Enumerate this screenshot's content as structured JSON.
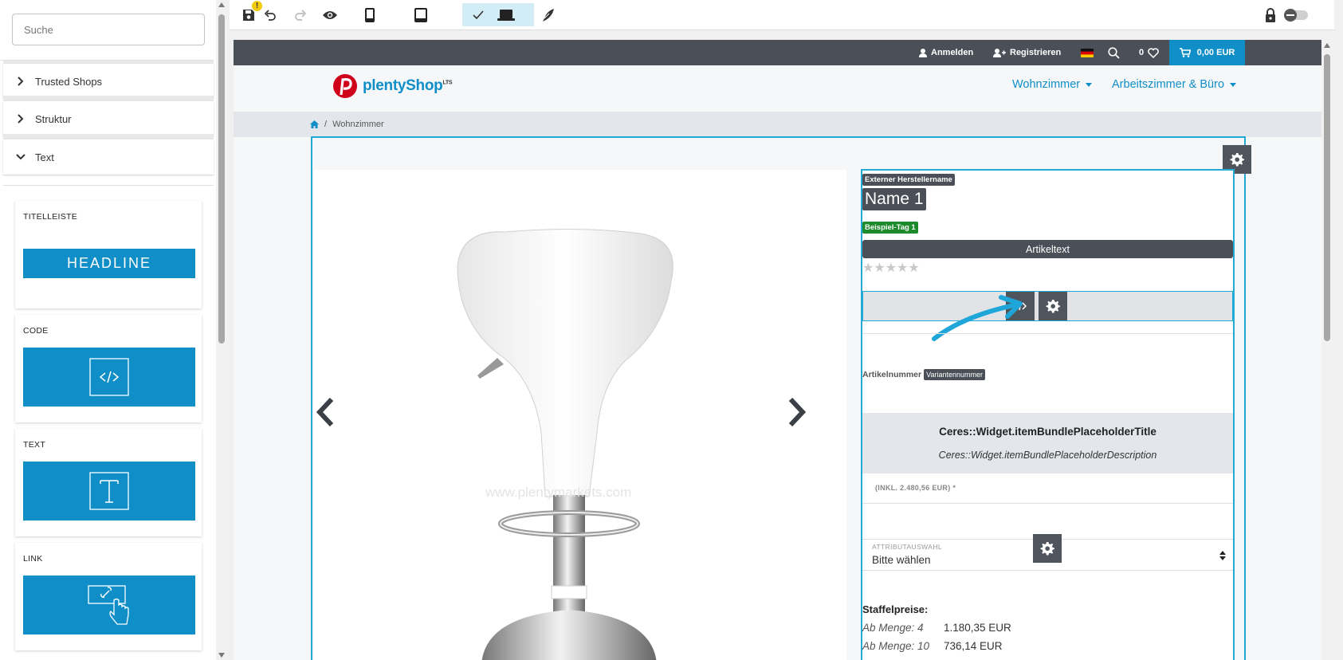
{
  "sidebar": {
    "search_placeholder": "Suche",
    "accordion": [
      {
        "label": "Trusted Shops",
        "expanded": false
      },
      {
        "label": "Struktur",
        "expanded": false
      },
      {
        "label": "Text",
        "expanded": true
      }
    ],
    "widgets": [
      {
        "label": "TITELLEISTE",
        "tile_text": "HEADLINE",
        "icon": "headline-icon"
      },
      {
        "label": "CODE",
        "icon": "code-icon"
      },
      {
        "label": "TEXT",
        "icon": "text-icon"
      },
      {
        "label": "LINK",
        "icon": "link-icon"
      }
    ]
  },
  "toolbar": {
    "tools": [
      "save-icon",
      "undo-icon",
      "redo-icon",
      "preview-eye-icon",
      "mobile-icon",
      "tablet-icon",
      "desktop-icon",
      "pen-icon",
      "lock-icon",
      "toggle-switch"
    ],
    "warning_badge": "!"
  },
  "shop": {
    "topbar": {
      "login": "Anmelden",
      "register": "Registrieren",
      "wishlist_count": "0",
      "cart": "0,00 EUR"
    },
    "logo_text": "plentyShop",
    "logo_sup": "LTS",
    "nav": [
      "Wohnzimmer",
      "Arbeitszimmer & Büro"
    ],
    "breadcrumb": [
      "Wohnzimmer"
    ]
  },
  "item": {
    "manufacturer": "Externer Herstellername",
    "name": "Name 1",
    "tag": "Beispiel-Tag 1",
    "article_text": "Artikeltext",
    "stars": "★★★★★",
    "code_slash": "/",
    "artnum_label": "Artikelnummer",
    "artnum_chip": "Variantennummer",
    "bundle_title": "Ceres::Widget.itemBundlePlaceholderTitle",
    "bundle_desc": "Ceres::Widget.itemBundlePlaceholderDescription",
    "price_note": "(INKL. 2.480,56 EUR) *",
    "attribute_label": "ATTRIBUTAUSWAHL",
    "attribute_value": "Bitte wählen",
    "graduated_title": "Staffelpreise:",
    "graduated_prices": [
      {
        "qty": "Ab Menge: 4",
        "price": "1.180,35 EUR"
      },
      {
        "qty": "Ab Menge: 10",
        "price": "736,14 EUR"
      }
    ],
    "image_watermark": "www.plentymarkets.com"
  },
  "colors": {
    "accent": "#0f8ec8",
    "selection": "#22a9d6",
    "dark": "#4b5058",
    "tag": "#1d8a2c"
  }
}
